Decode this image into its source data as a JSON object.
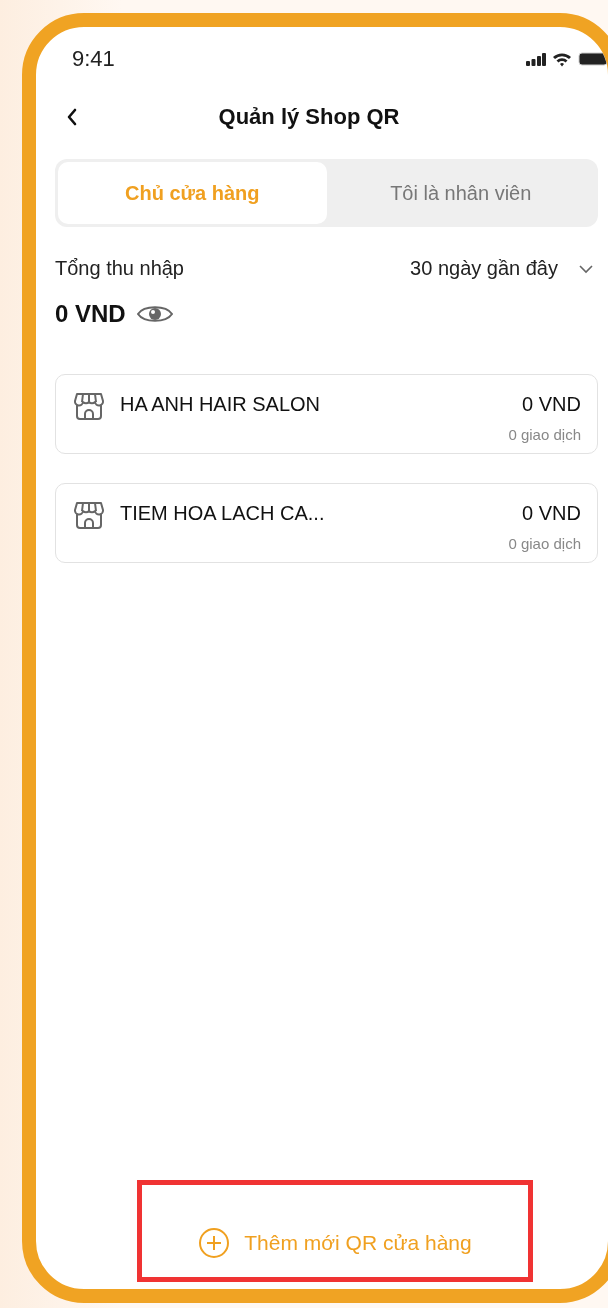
{
  "status_bar": {
    "time": "9:41"
  },
  "header": {
    "title": "Quản lý Shop QR"
  },
  "tabs": [
    {
      "label": "Chủ cửa hàng",
      "selected": true
    },
    {
      "label": "Tôi là nhân viên",
      "selected": false
    }
  ],
  "income": {
    "label": "Tổng thu nhập",
    "period": "30 ngày gần đây",
    "amount": "0 VND"
  },
  "shops": [
    {
      "name": "HA ANH HAIR SALON",
      "amount": "0 VND",
      "transactions": "0 giao dịch"
    },
    {
      "name": "TIEM HOA LACH CA...",
      "amount": "0 VND",
      "transactions": "0 giao dịch"
    }
  ],
  "add_button": {
    "label": "Thêm mới QR cửa hàng"
  }
}
